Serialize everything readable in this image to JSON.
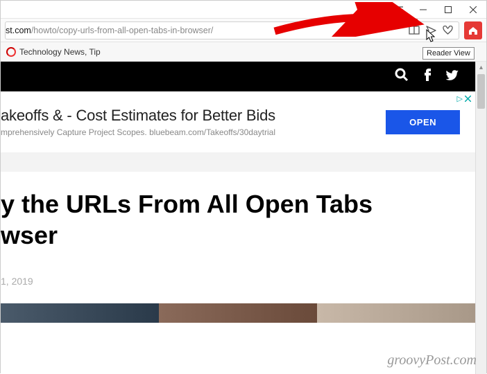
{
  "titlebar": {},
  "addressbar": {
    "url_root": "st.com",
    "url_path": "/howto/copy-urls-from-all-open-tabs-in-browser/"
  },
  "bookmarks": {
    "item1": "Technology News, Tip"
  },
  "tooltip": "Reader View",
  "ad": {
    "title": "akeoffs & - Cost Estimates for Better Bids",
    "subtitle": "mprehensively Capture Project Scopes. bluebeam.com/Takeoffs/30daytrial",
    "button": "OPEN",
    "choices": "▷"
  },
  "article": {
    "title": "y the URLs From All Open Tabs\nwser",
    "date": "1, 2019"
  },
  "watermark": "groovyPost.com"
}
